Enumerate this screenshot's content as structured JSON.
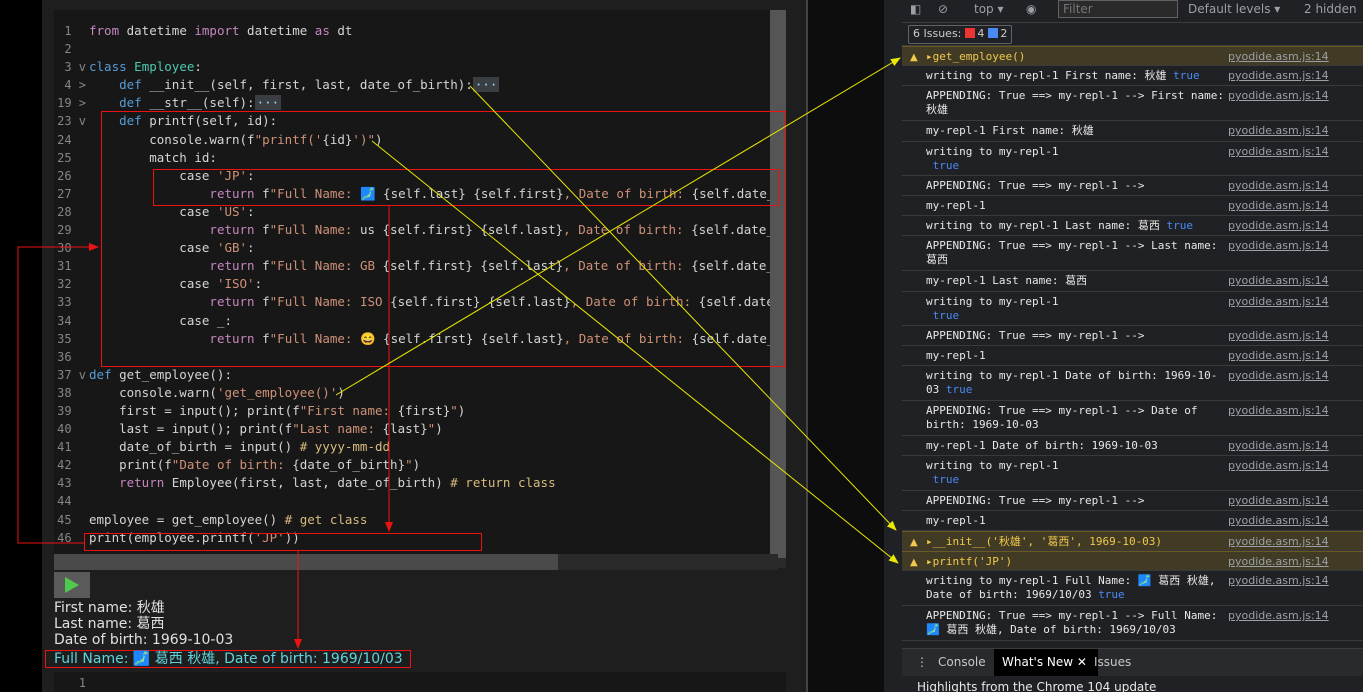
{
  "editor": {
    "line_numbers": [
      "1",
      "2",
      "3",
      "4",
      "19",
      "23",
      "24",
      "25",
      "26",
      "27",
      "28",
      "29",
      "30",
      "31",
      "32",
      "33",
      "34",
      "35",
      "36",
      "37",
      "38",
      "39",
      "40",
      "41",
      "42",
      "43",
      "44",
      "45",
      "46"
    ],
    "fold_markers": [
      "",
      "",
      "v",
      ">",
      ">",
      "v",
      "",
      "",
      "",
      "",
      "",
      "",
      "",
      "",
      "",
      "",
      "",
      "",
      "",
      "v",
      "",
      "",
      "",
      "",
      "",
      "",
      "",
      "",
      ""
    ],
    "code": [
      [
        {
          "t": "from",
          "c": "kw"
        },
        {
          "t": " datetime "
        },
        {
          "t": "import",
          "c": "kw"
        },
        {
          "t": " datetime "
        },
        {
          "t": "as",
          "c": "kw"
        },
        {
          "t": " dt"
        }
      ],
      [],
      [
        {
          "t": "class",
          "c": "bl"
        },
        {
          "t": " "
        },
        {
          "t": "Employee",
          "c": "cls"
        },
        {
          "t": ":"
        }
      ],
      [
        {
          "t": "    "
        },
        {
          "t": "def",
          "c": "bl"
        },
        {
          "t": " __init__(self, first, last, date_of_birth):"
        },
        {
          "t": "···",
          "c": "fold"
        }
      ],
      [
        {
          "t": "    "
        },
        {
          "t": "def",
          "c": "bl"
        },
        {
          "t": " __str__(self):"
        },
        {
          "t": "···",
          "c": "fold"
        }
      ],
      [
        {
          "t": "    "
        },
        {
          "t": "def",
          "c": "bl"
        },
        {
          "t": " printf(self, id):"
        }
      ],
      [
        {
          "t": "        console.warn(f"
        },
        {
          "t": "\"printf('",
          "c": "str"
        },
        {
          "t": "{id}"
        },
        {
          "t": "')\"",
          "c": "str"
        },
        {
          "t": ")"
        }
      ],
      [
        {
          "t": "        match id:"
        }
      ],
      [
        {
          "t": "            case "
        },
        {
          "t": "'JP'",
          "c": "str"
        },
        {
          "t": ":"
        }
      ],
      [
        {
          "t": "                "
        },
        {
          "t": "return",
          "c": "kw"
        },
        {
          "t": " f"
        },
        {
          "t": "\"Full Name: ",
          "c": "str"
        },
        {
          "t": "🗾 ",
          "c": "str"
        },
        {
          "t": "{self.last} {self.first}"
        },
        {
          "t": ", Date of birth: ",
          "c": "str"
        },
        {
          "t": "{self.date_of_birth"
        }
      ],
      [
        {
          "t": "            case "
        },
        {
          "t": "'US'",
          "c": "str"
        },
        {
          "t": ":"
        }
      ],
      [
        {
          "t": "                "
        },
        {
          "t": "return",
          "c": "kw"
        },
        {
          "t": " f"
        },
        {
          "t": "\"Full Name: ",
          "c": "str"
        },
        {
          "t": "us "
        },
        {
          "t": "{self.first} {self.last}"
        },
        {
          "t": ", Date of birth: ",
          "c": "str"
        },
        {
          "t": "{self.date_of_birth"
        }
      ],
      [
        {
          "t": "            case "
        },
        {
          "t": "'GB'",
          "c": "str"
        },
        {
          "t": ":"
        }
      ],
      [
        {
          "t": "                "
        },
        {
          "t": "return",
          "c": "kw"
        },
        {
          "t": " f"
        },
        {
          "t": "\"Full Name: ",
          "c": "str"
        },
        {
          "t": "GB ",
          "c": "str"
        },
        {
          "t": "{self.first} {self.last}"
        },
        {
          "t": ", Date of birth: ",
          "c": "str"
        },
        {
          "t": "{self.date_of_birth"
        }
      ],
      [
        {
          "t": "            case "
        },
        {
          "t": "'ISO'",
          "c": "str"
        },
        {
          "t": ":"
        }
      ],
      [
        {
          "t": "                "
        },
        {
          "t": "return",
          "c": "kw"
        },
        {
          "t": " f"
        },
        {
          "t": "\"Full Name: ISO ",
          "c": "str"
        },
        {
          "t": "{self.first} {self.last}"
        },
        {
          "t": ", Date of birth: ",
          "c": "str"
        },
        {
          "t": "{self.date_of_birth"
        }
      ],
      [
        {
          "t": "            case _:"
        }
      ],
      [
        {
          "t": "                "
        },
        {
          "t": "return",
          "c": "kw"
        },
        {
          "t": " f"
        },
        {
          "t": "\"Full Name: ",
          "c": "str"
        },
        {
          "t": "😄 "
        },
        {
          "t": "{self.first} {self.last}"
        },
        {
          "t": ", Date of birth: ",
          "c": "str"
        },
        {
          "t": "{self.date_of_birth"
        }
      ],
      [],
      [
        {
          "t": "def",
          "c": "bl"
        },
        {
          "t": " get_employee():"
        }
      ],
      [
        {
          "t": "    console.warn("
        },
        {
          "t": "'get_employee()'",
          "c": "str"
        },
        {
          "t": ")"
        }
      ],
      [
        {
          "t": "    first = input(); print(f"
        },
        {
          "t": "\"First name: ",
          "c": "str"
        },
        {
          "t": "{first}"
        },
        {
          "t": "\"",
          "c": "str"
        },
        {
          "t": ")"
        }
      ],
      [
        {
          "t": "    last = input(); print(f"
        },
        {
          "t": "\"Last name: ",
          "c": "str"
        },
        {
          "t": "{last}"
        },
        {
          "t": "\"",
          "c": "str"
        },
        {
          "t": ")"
        }
      ],
      [
        {
          "t": "    date_of_birth = input() "
        },
        {
          "t": "# yyyy-mm-dd",
          "c": "cm"
        }
      ],
      [
        {
          "t": "    print(f"
        },
        {
          "t": "\"Date of birth: ",
          "c": "str"
        },
        {
          "t": "{date_of_birth}"
        },
        {
          "t": "\"",
          "c": "str"
        },
        {
          "t": ")"
        }
      ],
      [
        {
          "t": "    "
        },
        {
          "t": "return",
          "c": "kw"
        },
        {
          "t": " Employee(first, last, date_of_birth) "
        },
        {
          "t": "# return class",
          "c": "cm"
        }
      ],
      [],
      [
        {
          "t": "employee = get_employee() "
        },
        {
          "t": "# get class",
          "c": "cm"
        }
      ],
      [
        {
          "t": "print(employee.printf("
        },
        {
          "t": "'JP'",
          "c": "str"
        },
        {
          "t": "))"
        }
      ]
    ],
    "second_editor_line": "1"
  },
  "output": {
    "run_label": "Run",
    "lines": [
      "First name: 秋雄",
      "Last name: 葛西",
      "Date of birth: 1969-10-03"
    ],
    "result": "Full Name: 🗾 葛西 秋雄, Date of birth: 1969/10/03"
  },
  "devtools": {
    "toolbar": {
      "context": "top ▾",
      "filter_placeholder": "Filter",
      "levels": "Default levels ▾",
      "hidden": "2 hidden"
    },
    "issues": {
      "label": "6 Issues:",
      "errors": "4",
      "infos": "2"
    },
    "messages": [
      {
        "type": "warn",
        "text": "▸get_employee()",
        "src": "pyodide.asm.js:14",
        "h": 20
      },
      {
        "type": "log",
        "text": "writing to my-repl-1 First name: 秋雄 ",
        "tval": "true",
        "src": "pyodide.asm.js:14",
        "h": 20
      },
      {
        "type": "log",
        "text": "APPENDING: True ==> my-repl-1 --> First name: 秋雄",
        "src": "pyodide.asm.js:14",
        "h": 35
      },
      {
        "type": "log",
        "text": "my-repl-1 First name: 秋雄",
        "src": "pyodide.asm.js:14",
        "h": 21
      },
      {
        "type": "log",
        "text": "writing to my-repl-1\n ",
        "tval": "true",
        "src": "pyodide.asm.js:14",
        "h": 34
      },
      {
        "type": "log",
        "text": "APPENDING: True ==> my-repl-1 -->",
        "src": "pyodide.asm.js:14",
        "h": 20
      },
      {
        "type": "log",
        "text": "my-repl-1",
        "src": "pyodide.asm.js:14",
        "h": 20
      },
      {
        "type": "log",
        "text": "writing to my-repl-1 Last name: 葛西 ",
        "tval": "true",
        "src": "pyodide.asm.js:14",
        "h": 20
      },
      {
        "type": "log",
        "text": "APPENDING: True ==> my-repl-1 --> Last name: 葛西",
        "src": "pyodide.asm.js:14",
        "h": 35
      },
      {
        "type": "log",
        "text": "my-repl-1 Last name: 葛西",
        "src": "pyodide.asm.js:14",
        "h": 21
      },
      {
        "type": "log",
        "text": "writing to my-repl-1\n ",
        "tval": "true",
        "src": "pyodide.asm.js:14",
        "h": 34
      },
      {
        "type": "log",
        "text": "APPENDING: True ==> my-repl-1 -->",
        "src": "pyodide.asm.js:14",
        "h": 20
      },
      {
        "type": "log",
        "text": "my-repl-1",
        "src": "pyodide.asm.js:14",
        "h": 20
      },
      {
        "type": "log",
        "text": "writing to my-repl-1 Date of birth: 1969-10-03 ",
        "tval": "true",
        "src": "pyodide.asm.js:14",
        "h": 35
      },
      {
        "type": "log",
        "text": "APPENDING: True ==> my-repl-1 --> Date of birth: 1969-10-03",
        "src": "pyodide.asm.js:14",
        "h": 35
      },
      {
        "type": "log",
        "text": "my-repl-1 Date of birth: 1969-10-03",
        "src": "pyodide.asm.js:14",
        "h": 20
      },
      {
        "type": "log",
        "text": "writing to my-repl-1\n ",
        "tval": "true",
        "src": "pyodide.asm.js:14",
        "h": 35
      },
      {
        "type": "log",
        "text": "APPENDING: True ==> my-repl-1 -->",
        "src": "pyodide.asm.js:14",
        "h": 20
      },
      {
        "type": "log",
        "text": "my-repl-1",
        "src": "pyodide.asm.js:14",
        "h": 20
      },
      {
        "type": "warn",
        "text": "▸__init__('秋雄', '葛西', 1969-10-03)",
        "src": "pyodide.asm.js:14",
        "h": 20
      },
      {
        "type": "warn",
        "text": "▸printf('JP')",
        "src": "pyodide.asm.js:14",
        "h": 20
      },
      {
        "type": "log",
        "text": "writing to my-repl-1 Full Name: 🗾 葛西 秋雄, Date of birth: 1969/10/03 ",
        "tval": "true",
        "src": "pyodide.asm.js:14",
        "h": 35
      },
      {
        "type": "log",
        "text": "APPENDING: True ==> my-repl-1 --> Full Name: 🗾 葛西 秋雄, Date of birth: 1969/10/03",
        "src": "pyodide.asm.js:14",
        "h": 35
      }
    ],
    "drawer_tabs": [
      "Console",
      "What's New",
      "Issues"
    ],
    "drawer_body": "Highlights from the Chrome 104 update"
  }
}
